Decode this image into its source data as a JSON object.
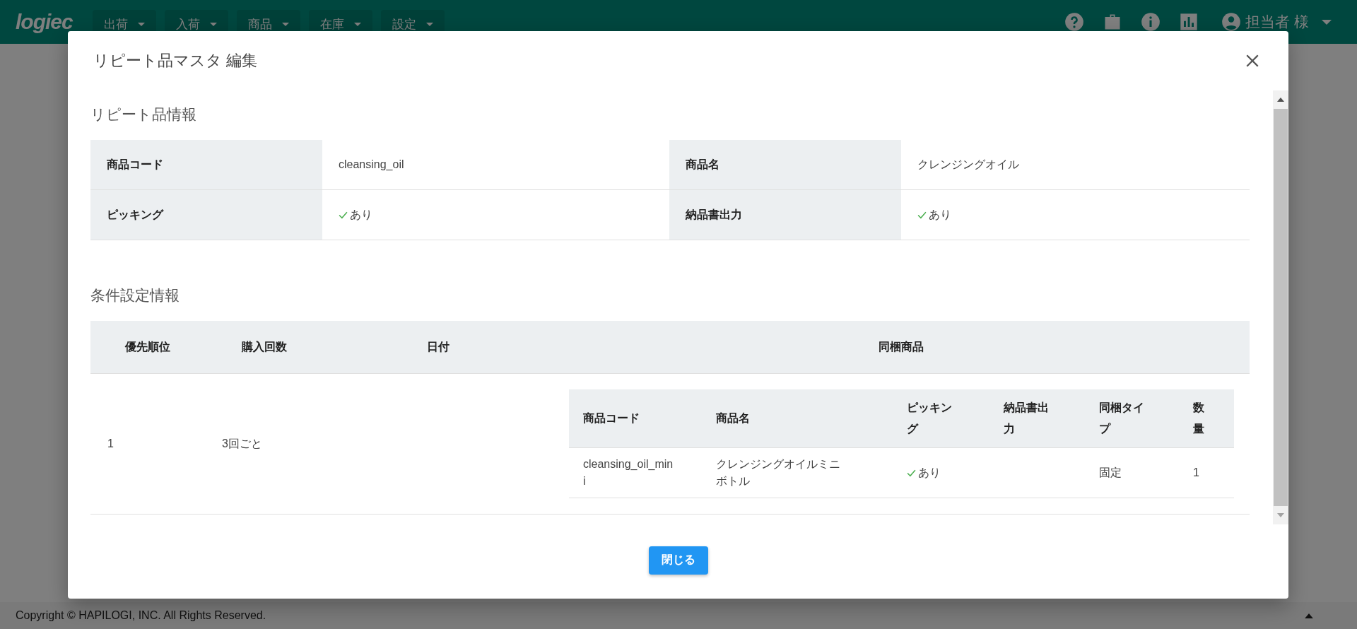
{
  "header": {
    "logo": "logiec",
    "menus": [
      {
        "label": "出荷"
      },
      {
        "label": "入荷"
      },
      {
        "label": "商品"
      },
      {
        "label": "在庫"
      },
      {
        "label": "設定"
      }
    ],
    "user": "担当者 様"
  },
  "modal": {
    "title": "リピート品マスタ 編集",
    "item_section": {
      "title": "リピート品情報",
      "fields": [
        {
          "label": "商品コード",
          "value": "cleansing_oil"
        },
        {
          "label": "商品名",
          "value": "クレンジングオイル"
        },
        {
          "label": "ピッキング",
          "value": "あり",
          "checked": true
        },
        {
          "label": "納品書出力",
          "value": "あり",
          "checked": true
        }
      ]
    },
    "condition_section": {
      "title": "条件設定情報",
      "columns": [
        "優先順位",
        "購入回数",
        "日付",
        "同梱商品"
      ],
      "rows": [
        {
          "priority": "1",
          "purchase_count": "3回ごと",
          "bundle": {
            "columns": [
              "商品コード",
              "商品名",
              "ピッキング",
              "納品書出力",
              "同梱タイプ",
              "数量"
            ],
            "rows": [
              {
                "code": "cleansing_oil_mini",
                "name": "クレンジングオイルミニボトル",
                "picking": {
                  "checked": true,
                  "label": "あり"
                },
                "bundle_type": "固定",
                "quantity": "1"
              }
            ]
          }
        }
      ]
    },
    "close_button": "閉じる"
  },
  "footer": {
    "copyright": "Copyright © HAPILOGI, INC. All Rights Reserved."
  }
}
